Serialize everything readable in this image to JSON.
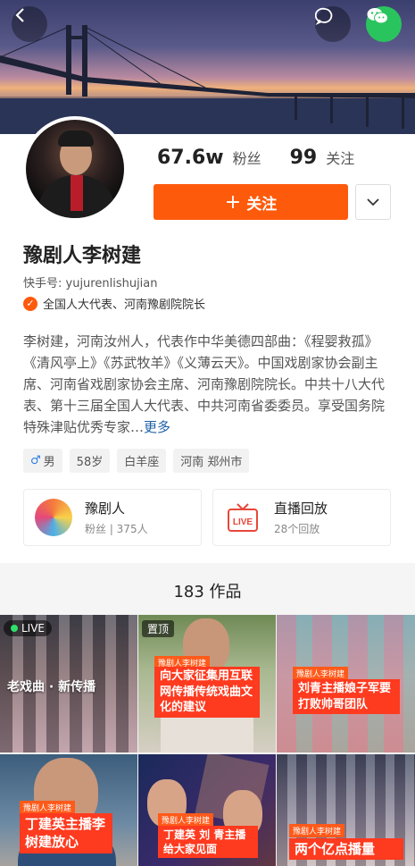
{
  "profile": {
    "fans_count": "67.6w",
    "fans_label": "粉丝",
    "following_count": "99",
    "following_label": "关注",
    "follow_button": "关注",
    "name": "豫剧人李树建",
    "kuaishou_id": "快手号: yujurenlishujian",
    "certification": "全国人大代表、河南豫剧院院长",
    "bio": "李树建，河南汝州人，代表作中华美德四部曲：《程婴救孤》《清风亭上》《苏武牧羊》《义薄云天》。中国戏剧家协会副主席、河南省戏剧家协会主席、河南豫剧院院长。中共十八大代表、第十三届全国人大代表、中共河南省委委员。享受国务院特殊津贴优秀专家…",
    "bio_more": "更多",
    "tags": [
      "男",
      "58岁",
      "白羊座",
      "河南 郑州市"
    ]
  },
  "cards": {
    "group": {
      "title": "豫剧人",
      "subtitle": "粉丝 | 375人"
    },
    "replay": {
      "title": "直播回放",
      "subtitle": "28个回放",
      "icon_text": "LIVE"
    }
  },
  "works": {
    "title": "183 作品",
    "items": [
      {
        "badge": "LIVE",
        "overlay": "老戏曲 · 新传播"
      },
      {
        "badge": "置顶",
        "tag": "豫剧人李树建",
        "caption": "向大家征集用互联网传播传统戏曲文化的建议"
      },
      {
        "tag": "豫剧人李树建",
        "caption": "刘青主播娘子军要打败帅哥团队"
      },
      {
        "tag": "豫剧人李树建",
        "caption": "丁建英主播李树建放心"
      },
      {
        "tag": "豫剧人李树建",
        "caption": "丁建英  刘 青主播给大家见面"
      },
      {
        "tag": "豫剧人李树建",
        "caption": "两个亿点播量"
      }
    ]
  },
  "colors": {
    "accent": "#fe5a0c",
    "caption_red": "#fe3a1f"
  }
}
